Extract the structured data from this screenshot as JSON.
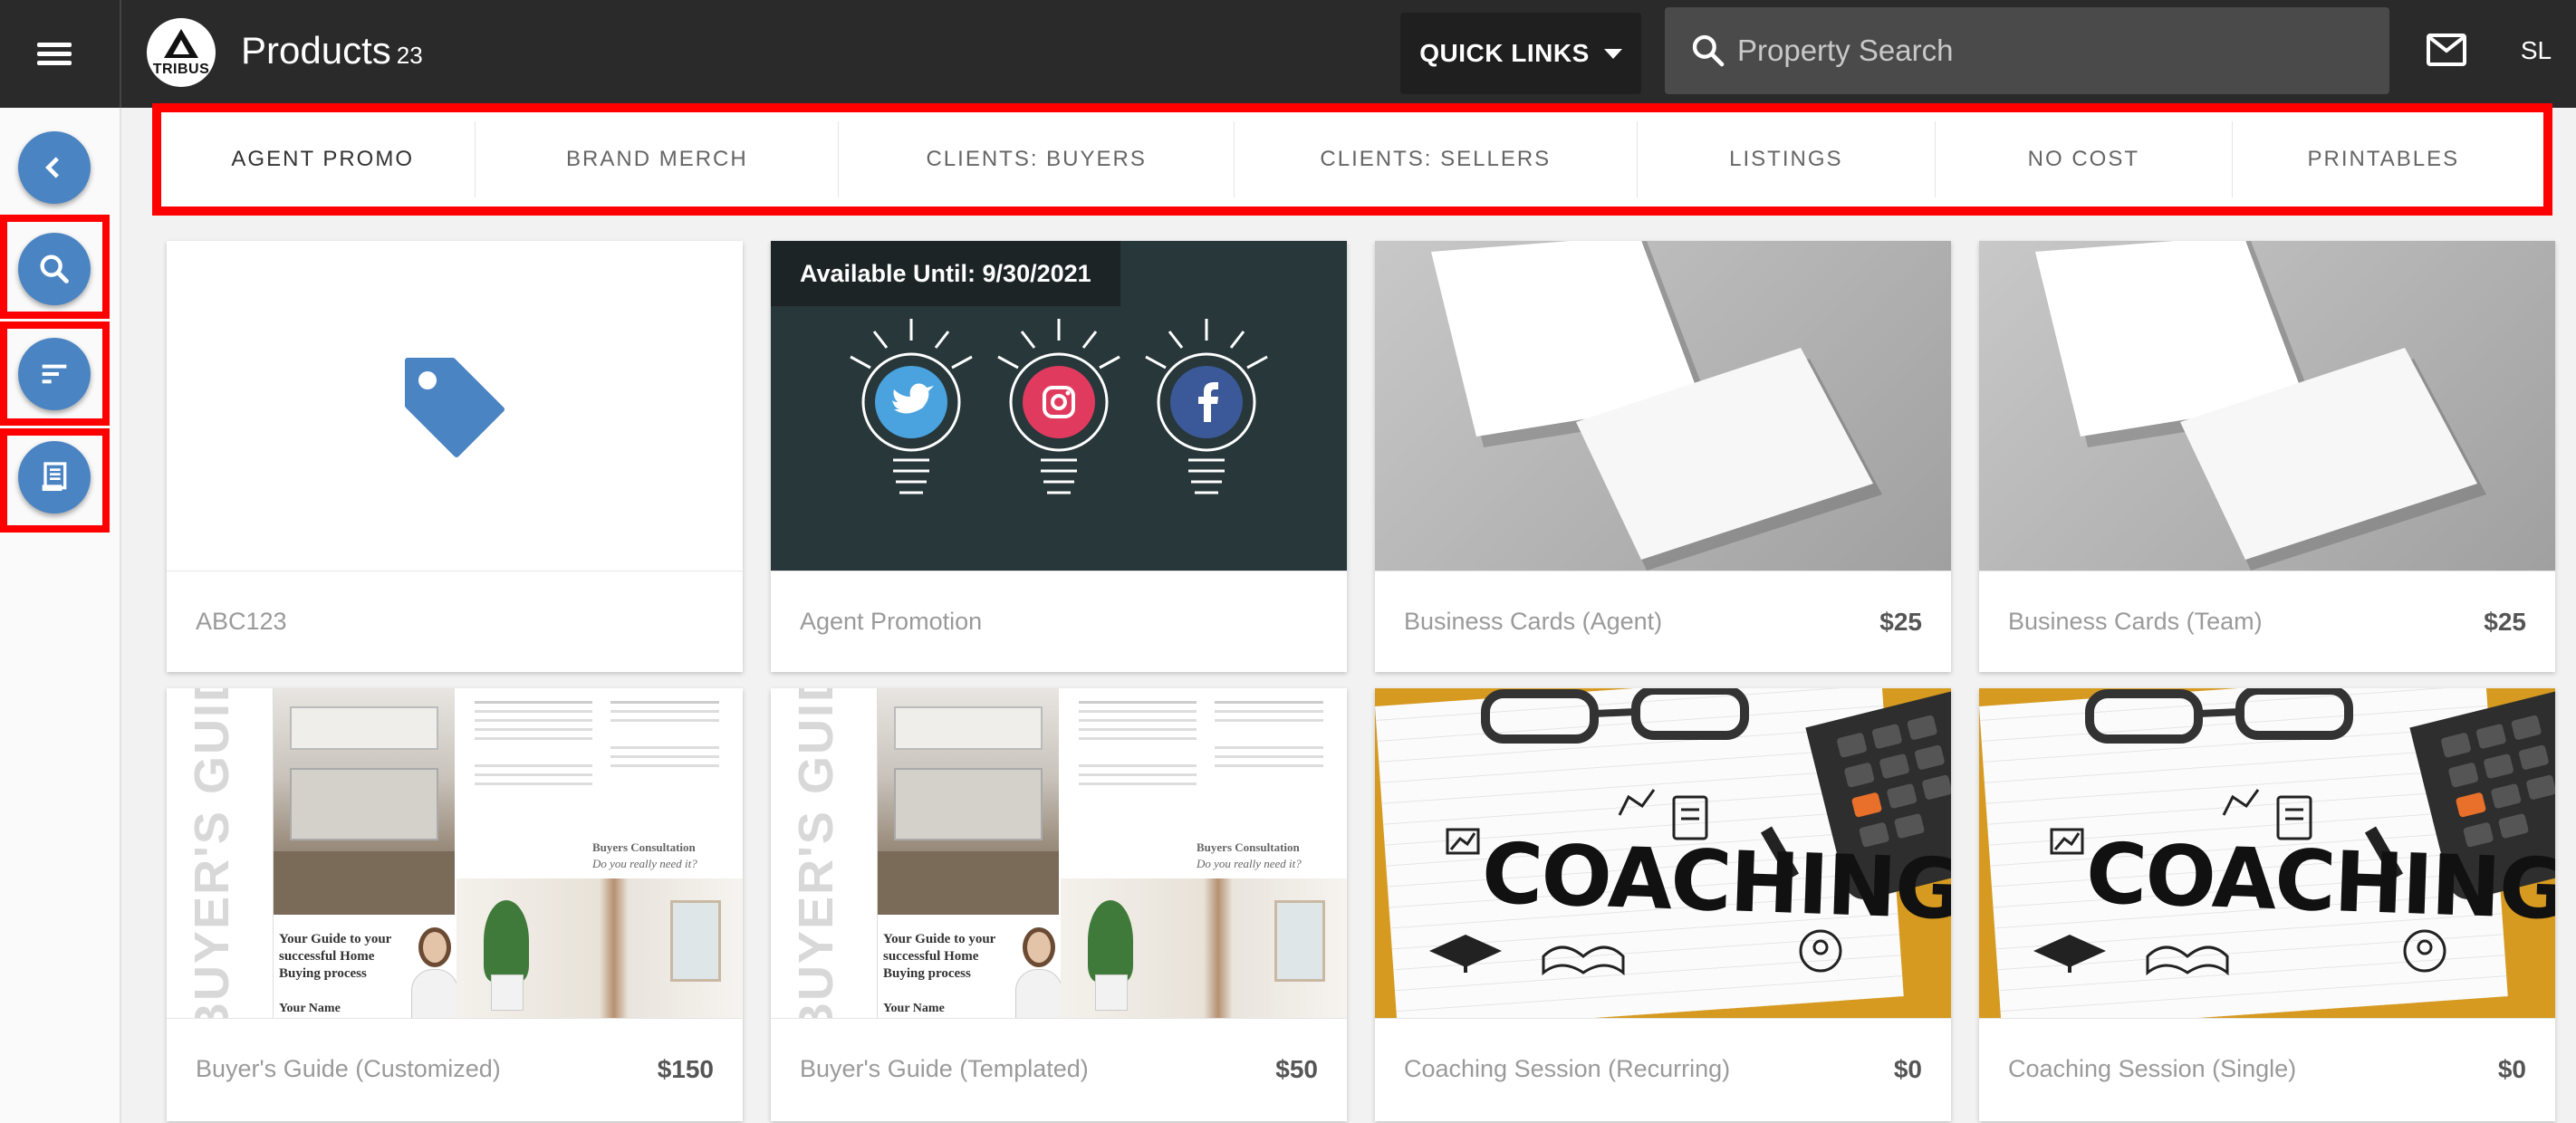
{
  "header": {
    "title": "Products",
    "count": "23",
    "logo_text": "TRIBUS",
    "quick_links_label": "QUICK LINKS",
    "search_placeholder": "Property Search",
    "avatar_initials": "SL"
  },
  "tabs": [
    {
      "label": "AGENT PROMO",
      "active": true
    },
    {
      "label": "BRAND MERCH",
      "active": false
    },
    {
      "label": "CLIENTS: BUYERS",
      "active": false
    },
    {
      "label": "CLIENTS: SELLERS",
      "active": false
    },
    {
      "label": "LISTINGS",
      "active": false
    },
    {
      "label": "NO COST",
      "active": false
    },
    {
      "label": "PRINTABLES",
      "active": false
    }
  ],
  "products": [
    {
      "name": "ABC123",
      "price": "",
      "image": "tag-icon"
    },
    {
      "name": "Agent Promotion",
      "price": "",
      "image": "social-bulbs",
      "badge": "Available Until: 9/30/2021"
    },
    {
      "name": "Business Cards (Agent)",
      "price": "$25",
      "image": "business-cards"
    },
    {
      "name": "Business Cards (Team)",
      "price": "$25",
      "image": "business-cards"
    },
    {
      "name": "Buyer's Guide (Customized)",
      "price": "$150",
      "image": "buyers-guide"
    },
    {
      "name": "Buyer's Guide (Templated)",
      "price": "$50",
      "image": "buyers-guide"
    },
    {
      "name": "Coaching Session (Recurring)",
      "price": "$0",
      "image": "coaching"
    },
    {
      "name": "Coaching Session (Single)",
      "price": "$0",
      "image": "coaching"
    }
  ],
  "guide_text": {
    "spine": "BUYER'S GUID",
    "headline": "Your Guide to your successful Home Buying process",
    "name_line": "Your Name",
    "consult": "Buyers Consultation",
    "script": "Do you really need it?",
    "coaching_word": "COACHING"
  },
  "colors": {
    "topbar": "#2a2a2a",
    "accent_blue": "#4a84c3",
    "highlight_red": "#ff0000",
    "twitter": "#4aa3df",
    "instagram": "#e03b5f",
    "facebook": "#3b5998"
  }
}
